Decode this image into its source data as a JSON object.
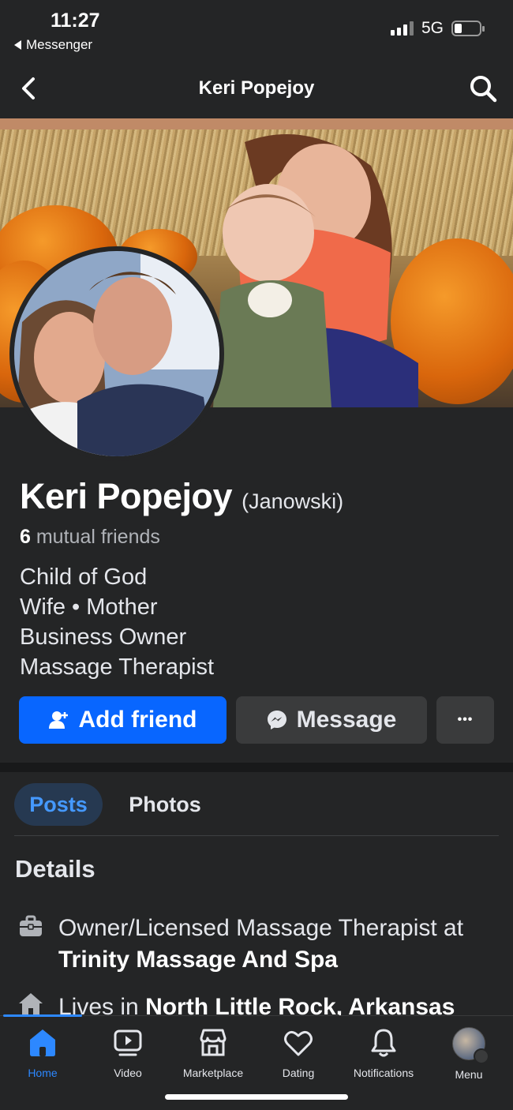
{
  "status_bar": {
    "time": "11:27",
    "back_app": "Messenger",
    "network": "5G"
  },
  "nav": {
    "title": "Keri Popejoy"
  },
  "profile": {
    "name": "Keri Popejoy",
    "alt_name": "(Janowski)",
    "mutual_count": "6",
    "mutual_text": "mutual friends",
    "bio": [
      "Child of God",
      "Wife • Mother",
      "Business Owner",
      "Massage Therapist"
    ]
  },
  "actions": {
    "add_friend": "Add friend",
    "message": "Message",
    "more": "•••"
  },
  "tabs": [
    {
      "label": "Posts"
    },
    {
      "label": "Photos"
    }
  ],
  "details": {
    "heading": "Details",
    "work_prefix": "Owner/Licensed Massage Therapist at",
    "work_place": "Trinity Massage And Spa",
    "lives_prefix": "Lives in",
    "lives_place": "North Little Rock, Arkansas"
  },
  "bottom_nav": [
    {
      "label": "Home",
      "icon": "home-icon"
    },
    {
      "label": "Video",
      "icon": "video-icon"
    },
    {
      "label": "Marketplace",
      "icon": "marketplace-icon"
    },
    {
      "label": "Dating",
      "icon": "dating-icon"
    },
    {
      "label": "Notifications",
      "icon": "bell-icon"
    },
    {
      "label": "Menu",
      "icon": "menu-avatar"
    }
  ],
  "colors": {
    "accent": "#0866ff",
    "background": "#242526",
    "secondary_button": "#3a3b3c",
    "active_tab_text": "#4599ff"
  }
}
